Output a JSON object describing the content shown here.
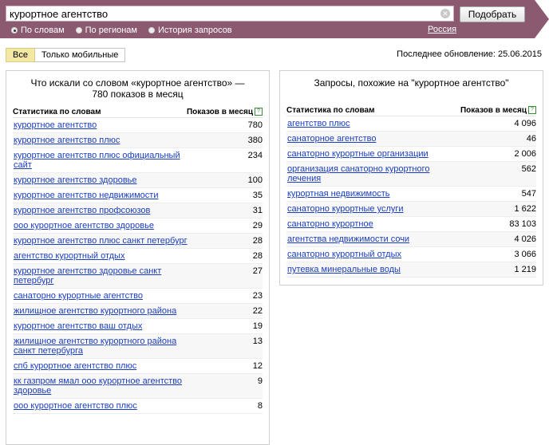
{
  "search": {
    "query": "курортное агентство",
    "button": "Подобрать"
  },
  "modes": [
    {
      "label": "По словам",
      "selected": true
    },
    {
      "label": "По регионам",
      "selected": false
    },
    {
      "label": "История запросов",
      "selected": false
    }
  ],
  "region": "Россия",
  "filters": {
    "all": "Все",
    "mobile": "Только мобильные"
  },
  "last_update": "Последнее обновление: 25.06.2015",
  "left": {
    "title": "Что искали со словом «курортное агентство» — 780 показов в месяц",
    "col_words": "Статистика по словам",
    "col_shows": "Показов в месяц",
    "rows": [
      {
        "q": "курортное агентство",
        "n": "780"
      },
      {
        "q": "курортное агентство плюс",
        "n": "380"
      },
      {
        "q": "курортное агентство плюс официальный сайт",
        "n": "234"
      },
      {
        "q": "курортное агентство здоровье",
        "n": "100"
      },
      {
        "q": "курортное агентство недвижимости",
        "n": "35"
      },
      {
        "q": "курортное агентство профсоюзов",
        "n": "31"
      },
      {
        "q": "ооо курортное агентство здоровье",
        "n": "29"
      },
      {
        "q": "курортное агентство плюс санкт петербург",
        "n": "28"
      },
      {
        "q": "агентство курортный отдых",
        "n": "28"
      },
      {
        "q": "курортное агентство здоровье санкт петербург",
        "n": "27"
      },
      {
        "q": "санаторно курортные агентство",
        "n": "23"
      },
      {
        "q": "жилищное агентство курортного района",
        "n": "22"
      },
      {
        "q": "курортное агентство ваш отдых",
        "n": "19"
      },
      {
        "q": "жилищное агентство курортного района санкт петербурга",
        "n": "13"
      },
      {
        "q": "спб курортное агентство плюс",
        "n": "12"
      },
      {
        "q": "кк газпром ямал ооо курортное агентство здоровье",
        "n": "9"
      },
      {
        "q": "ооо курортное агентство плюс",
        "n": "8"
      }
    ]
  },
  "right": {
    "title": "Запросы, похожие на \"курортное агентство\"",
    "col_words": "Статистика по словам",
    "col_shows": "Показов в месяц",
    "rows": [
      {
        "q": "агентство плюс",
        "n": "4 096"
      },
      {
        "q": "санаторное агентство",
        "n": "46"
      },
      {
        "q": "санаторно курортные организации",
        "n": "2 006"
      },
      {
        "q": "организация санаторно курортного лечения",
        "n": "562"
      },
      {
        "q": "курортная недвижимость",
        "n": "547"
      },
      {
        "q": "санаторно курортные услуги",
        "n": "1 622"
      },
      {
        "q": "санаторно курортное",
        "n": "83 103"
      },
      {
        "q": "агентства недвижимости сочи",
        "n": "4 026"
      },
      {
        "q": "санаторно курортный отдых",
        "n": "3 066"
      },
      {
        "q": "путевка минеральные воды",
        "n": "1 219"
      }
    ]
  }
}
